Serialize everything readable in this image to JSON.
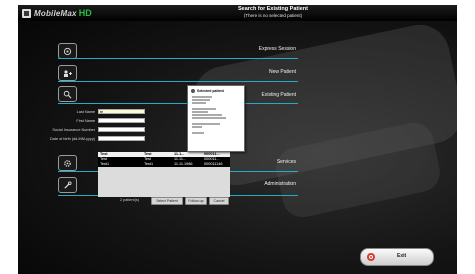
{
  "app": {
    "logo_text": "MobileMax",
    "logo_suffix": "HD",
    "title": "Search for Existing Patient",
    "subtitle": "(There is no selected patient)"
  },
  "menu": {
    "items": [
      {
        "label": "Express Session",
        "icon": "lock-icon"
      },
      {
        "label": "New Patient",
        "icon": "add-patient-icon"
      },
      {
        "label": "Existing Patient",
        "icon": "search-icon"
      },
      {
        "label": "Services",
        "icon": "gear-icon"
      },
      {
        "label": "Administration",
        "icon": "wrench-icon"
      }
    ]
  },
  "search_form": {
    "fields": [
      {
        "label": "Last Name",
        "value": "te"
      },
      {
        "label": "First Name",
        "value": ""
      },
      {
        "label": "Social Insurance Number",
        "value": ""
      },
      {
        "label": "Date of birth (dd-MM-yyyy)",
        "value": ""
      }
    ]
  },
  "results": {
    "columns": [
      "Test",
      "Test",
      "11.1...",
      "000011..."
    ],
    "rows": [
      [
        "Test",
        "Test",
        "11.11...",
        "000011..."
      ],
      [
        "Test1",
        "Test1",
        "11.11.1986",
        "000011146"
      ]
    ],
    "count_text": "2 patient(s)"
  },
  "buttons": {
    "select_patient": "Select Patient",
    "follow_up": "Follow-up",
    "cancel": "Cancel",
    "exit": "Exit"
  },
  "popup": {
    "title": "Selected patient"
  }
}
